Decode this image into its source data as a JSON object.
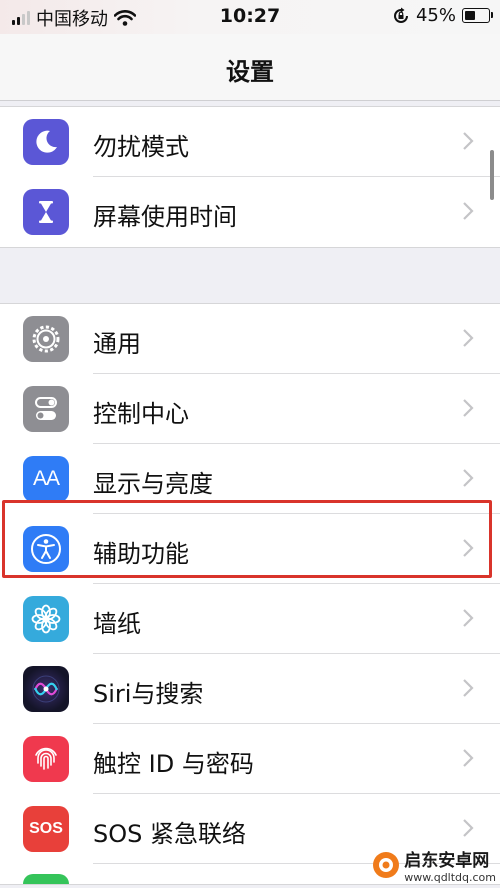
{
  "status_bar": {
    "carrier": "中国移动",
    "time": "10:27",
    "battery_percent_text": "45%",
    "battery_level": 0.45
  },
  "nav": {
    "title": "设置"
  },
  "group1": [
    {
      "label": "勿扰模式",
      "icon": "moon-icon",
      "color": "#5b57d6"
    },
    {
      "label": "屏幕使用时间",
      "icon": "hourglass-icon",
      "color": "#5b57d6"
    }
  ],
  "group2": [
    {
      "label": "通用",
      "icon": "gear-icon",
      "color": "#8e8e93"
    },
    {
      "label": "控制中心",
      "icon": "toggles-icon",
      "color": "#8e8e93"
    },
    {
      "label": "显示与亮度",
      "icon": "text-size-icon",
      "color": "#2f7cf6"
    },
    {
      "label": "辅助功能",
      "icon": "accessibility-icon",
      "color": "#2f7cf6"
    },
    {
      "label": "墙纸",
      "icon": "flower-icon",
      "color": "#35aadc"
    },
    {
      "label": "Siri与搜索",
      "icon": "siri-icon",
      "color": "#1b1b2e"
    },
    {
      "label": "触控 ID 与密码",
      "icon": "fingerprint-icon",
      "color": "#f0394e"
    },
    {
      "label": "SOS 紧急联络",
      "icon": "sos-icon",
      "color": "#e8403a"
    }
  ],
  "icon_text": {
    "text_size": "AA",
    "sos": "SOS"
  },
  "watermark": {
    "name": "启东安卓网",
    "url": "www.qdltdq.com"
  }
}
